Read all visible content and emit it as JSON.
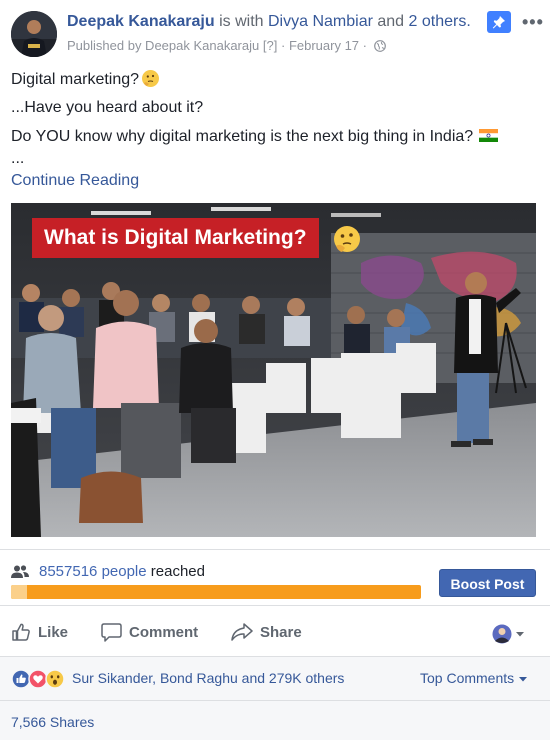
{
  "post": {
    "author": "Deepak Kanakaraju",
    "with_text": "is with",
    "tagged": "Divya Nambiar",
    "and_text": "and",
    "others": "2 others.",
    "published_by": "Published by Deepak Kanakaraju",
    "help_mark": "[?]",
    "date": "February 17",
    "separator": "·",
    "line1": "Digital marketing?",
    "line2": "...Have you heard about it?",
    "line3": "Do YOU know why digital marketing is the next big thing in India?",
    "ellipsis": "...",
    "continue": "Continue Reading",
    "image_title": "What is Digital Marketing?"
  },
  "insights": {
    "reach_count": "8557516 people",
    "reach_label": "reached",
    "progress": 0.04,
    "boost": "Boost Post"
  },
  "actions": {
    "like": "Like",
    "comment": "Comment",
    "share": "Share"
  },
  "reactions": {
    "names": "Sur Sikander, Bond Raghu and 279K others",
    "sort": "Top Comments"
  },
  "shares": "7,566 Shares",
  "colors": {
    "link": "#365899",
    "brand": "#4267b2",
    "progress": "#f79c1c",
    "title_bg": "#c62026"
  },
  "icons": [
    "avatar",
    "pin-icon",
    "more-icon",
    "globe-icon",
    "thinking-emoji-icon",
    "india-flag-icon",
    "people-icon",
    "like-icon",
    "comment-icon",
    "share-icon",
    "audience-icon",
    "like-reaction-icon",
    "love-reaction-icon",
    "wow-reaction-icon",
    "caret-down-icon"
  ]
}
